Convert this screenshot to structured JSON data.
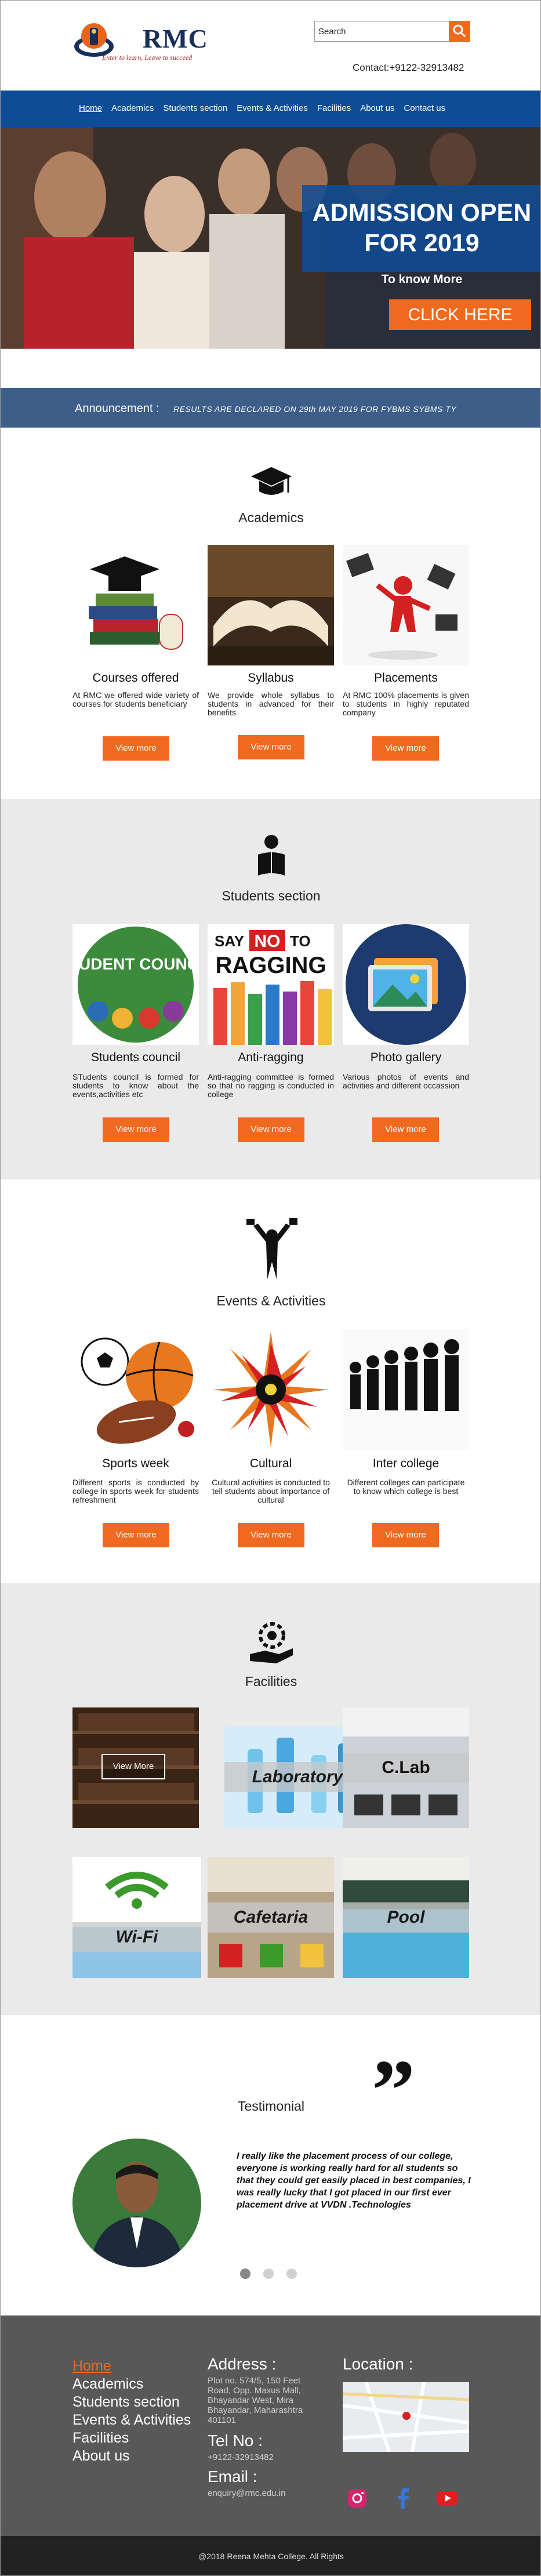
{
  "brand": {
    "name": "RMC",
    "tagline": "Enter to learn, Leave to succeed"
  },
  "search": {
    "label": "Search"
  },
  "contact": "Contact:+9122-32913482",
  "nav": {
    "items": [
      "Home",
      "Academics",
      "Students section",
      "Events & Activities",
      "Facilities",
      "About us",
      "Contact us"
    ]
  },
  "hero": {
    "title": "ADMISSION OPEN FOR 2019",
    "subtitle": "To know More",
    "cta": "CLICK HERE"
  },
  "announcement": {
    "label": "Announcement :",
    "text": "RESULTS ARE DECLARED ON 29th MAY 2019 FOR FYBMS SYBMS TY"
  },
  "academics": {
    "title": "Academics",
    "icon": "graduation-cap-icon",
    "cards": [
      {
        "title": "Courses offered",
        "desc": "At RMC we offered wide variety of courses for students beneficiary",
        "button": "View more"
      },
      {
        "title": "Syllabus",
        "desc": "We provide whole syllabus to students in advanced for their benefits",
        "button": "View more"
      },
      {
        "title": "Placements",
        "desc": "At RMC 100% placements is given to students in highly reputated company",
        "button": "View more"
      }
    ]
  },
  "students": {
    "title": "Students section",
    "icon": "student-reading-icon",
    "cards": [
      {
        "title": "Students council",
        "desc": "STudents council is formed for students to know about the events,activities etc",
        "button": "View more",
        "image_text": "STUDENT COUNCIL"
      },
      {
        "title": "Anti-ragging",
        "desc": "Anti-ragging committee is formed so that no ragging is conducted in college",
        "button": "View more",
        "image_text_1": "SAY",
        "image_text_2": "NO",
        "image_text_3": "TO",
        "image_text_4": "RAGGING"
      },
      {
        "title": "Photo gallery",
        "desc": "Various photos of events and activities and different occassion",
        "button": "View more"
      }
    ]
  },
  "events": {
    "title": "Events & Activities",
    "icon": "performer-icon",
    "cards": [
      {
        "title": "Sports week",
        "desc": "Different sports is conducted by college in sports week for students refreshment",
        "button": "View more"
      },
      {
        "title": "Cultural",
        "desc": "Cultural activities is conducted to tell students about importance of cultural",
        "button": "View more"
      },
      {
        "title": "Inter college",
        "desc": "Different colleges can participate to know which college is best",
        "button": "View more"
      }
    ]
  },
  "facilities": {
    "title": "Facilities",
    "icon": "gear-hand-icon",
    "library_button": "View More",
    "items": [
      "Laboratory",
      "C.Lab",
      "Wi-Fi",
      "Cafetaria",
      "Pool"
    ]
  },
  "testimonial": {
    "title": "Testimonial",
    "quote": "I really like the placement process of our college, everyone is working really hard for all students so that they could get easily placed in best companies, I was really lucky that I got placed in our first ever placement drive at VVDN .Technologies"
  },
  "footer": {
    "links": [
      "Home",
      "Academics",
      "Students section",
      "Events & Activities",
      "Facilities",
      "About us"
    ],
    "address_title": "Address :",
    "address": "Plot no. 574/5, 150 Feet Road, Opp. Maxus Mall, Bhayandar West, Mira Bhayandar, Maharashtra 401101",
    "tel_title": "Tel No :",
    "tel": "+9122-32913482",
    "email_title": "Email :",
    "email": "enquiry@rmc.edu.in",
    "location_title": "Location :"
  },
  "copyright": "@2018 Reena Mehta College. All Rights",
  "colors": {
    "brand_blue": "#0e4c98",
    "accent_orange": "#ef6a1f",
    "footer_gray": "#585858"
  }
}
